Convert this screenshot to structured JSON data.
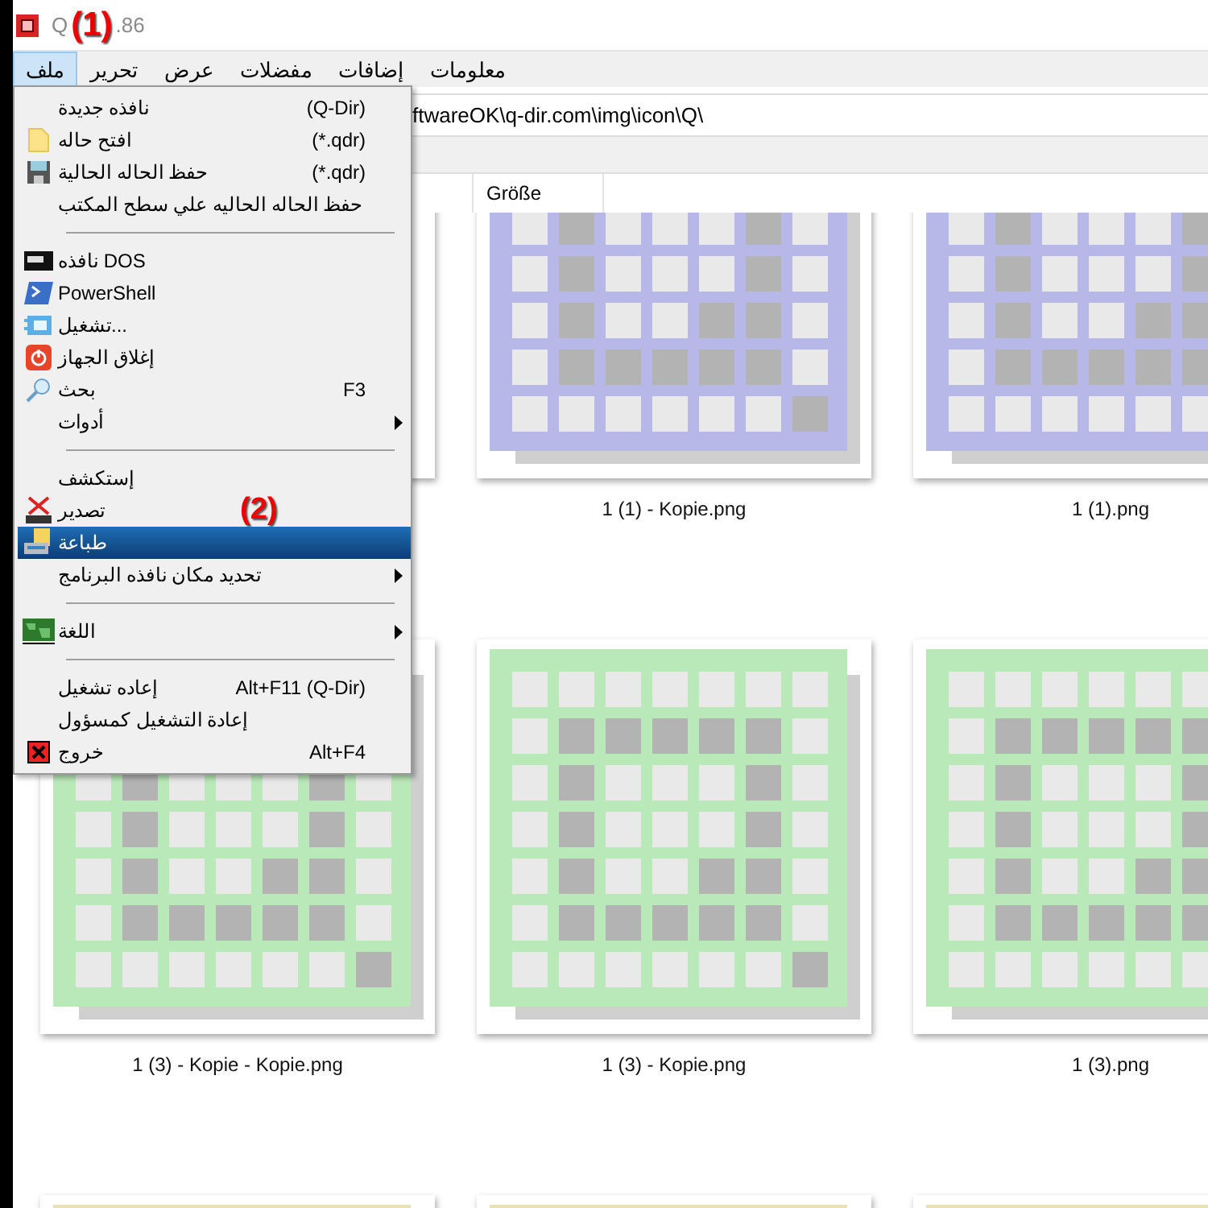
{
  "title_bar": {
    "title_start": "Q",
    "annotation": "(1)",
    "title_end": ".86"
  },
  "menu_bar": [
    {
      "label": "معلومات",
      "selected": false
    },
    {
      "label": "إضافات",
      "selected": false
    },
    {
      "label": "مفضلات",
      "selected": false
    },
    {
      "label": "عرض",
      "selected": false
    },
    {
      "label": "تحرير",
      "selected": false
    },
    {
      "label": "ملف",
      "selected": true
    }
  ],
  "address_bar": {
    "path": "ftwareOK\\q-dir.com\\img\\icon\\Q\\"
  },
  "column_header": {
    "label": "Größe"
  },
  "file_rows": [
    {
      "files": [
        {
          "label": "1 (1).png",
          "color": "#b7b7e8"
        },
        {
          "label": "1 (1) - Kopie.png",
          "color": "#b7b7e8"
        }
      ]
    },
    {
      "files": [
        {
          "label": "1 (3).png",
          "color": "#b9e8b9"
        },
        {
          "label": "1 (3) - Kopie.png",
          "color": "#b9e8b9"
        },
        {
          "label": "1 (3) - Kopie - Kopie.png",
          "color": "#b9e8b9"
        }
      ]
    },
    {
      "files": [
        {
          "color": "#e8e0b7"
        },
        {
          "color": "#e8e0b7"
        },
        {
          "color": "#e8e0b7"
        }
      ]
    }
  ],
  "file_menu": {
    "annotation": "(2)",
    "items": [
      {
        "kind": "item",
        "label": "نافذه جديدة",
        "shortcut": "(Q-Dir)",
        "submenu": false,
        "selected": false
      },
      {
        "kind": "item",
        "label": "افتح حاله",
        "shortcut": "(*.qdr)",
        "submenu": false,
        "selected": false
      },
      {
        "kind": "item",
        "label": "حفظ الحاله الحالية",
        "shortcut": "(*.qdr)",
        "submenu": false,
        "selected": false
      },
      {
        "kind": "item",
        "label": "حفظ الحاله الحاليه علي سطح المكتب",
        "submenu": false,
        "selected": false
      },
      {
        "kind": "separator"
      },
      {
        "kind": "item",
        "label": "نافذه DOS",
        "submenu": false,
        "selected": false
      },
      {
        "kind": "item",
        "label": "PowerShell",
        "submenu": false,
        "selected": false
      },
      {
        "kind": "item",
        "label": "تشغيل...",
        "submenu": false,
        "selected": false
      },
      {
        "kind": "item",
        "label": "إغلاق الجهاز",
        "submenu": false,
        "selected": false
      },
      {
        "kind": "item",
        "label": "بحث",
        "shortcut": "F3",
        "submenu": false,
        "selected": false
      },
      {
        "kind": "item",
        "label": "أدوات",
        "submenu": true,
        "selected": false
      },
      {
        "kind": "separator"
      },
      {
        "kind": "item",
        "label": "إستكشف",
        "submenu": false,
        "selected": false
      },
      {
        "kind": "item",
        "label": "تصدير",
        "submenu": false,
        "selected": false
      },
      {
        "kind": "item",
        "label": "طباعة",
        "submenu": false,
        "selected": true
      },
      {
        "kind": "item",
        "label": "تحديد مكان نافذه البرنامج",
        "submenu": true,
        "selected": false
      },
      {
        "kind": "separator"
      },
      {
        "kind": "item",
        "label": "اللغة",
        "submenu": true,
        "selected": false
      },
      {
        "kind": "separator"
      },
      {
        "kind": "item",
        "label": "إعاده تشغيل",
        "shortcut": "Alt+F11 (Q-Dir)",
        "submenu": false,
        "selected": false
      },
      {
        "kind": "item",
        "label": "إعادة التشغيل كمسؤول",
        "submenu": false,
        "selected": false
      },
      {
        "kind": "item",
        "label": "خروج",
        "shortcut": "Alt+F4",
        "submenu": false,
        "selected": false
      }
    ]
  }
}
